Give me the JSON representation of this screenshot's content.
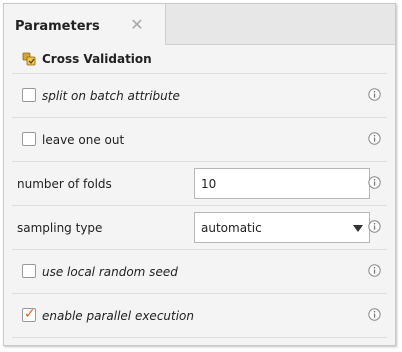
{
  "panel": {
    "title": "Parameters"
  },
  "section": {
    "title": "Cross Validation"
  },
  "params": {
    "split_on_batch_attribute": {
      "label": "split on batch attribute",
      "checked": false
    },
    "leave_one_out": {
      "label": "leave one out",
      "checked": false
    },
    "number_of_folds": {
      "label": "number of folds",
      "value": "10"
    },
    "sampling_type": {
      "label": "sampling type",
      "value": "automatic"
    },
    "use_local_random_seed": {
      "label": "use local random seed",
      "checked": false
    },
    "enable_parallel_execution": {
      "label": "enable parallel execution",
      "checked": true
    }
  },
  "colors": {
    "checkmark": "#e8651a",
    "accent_icon": "#c8901a"
  }
}
